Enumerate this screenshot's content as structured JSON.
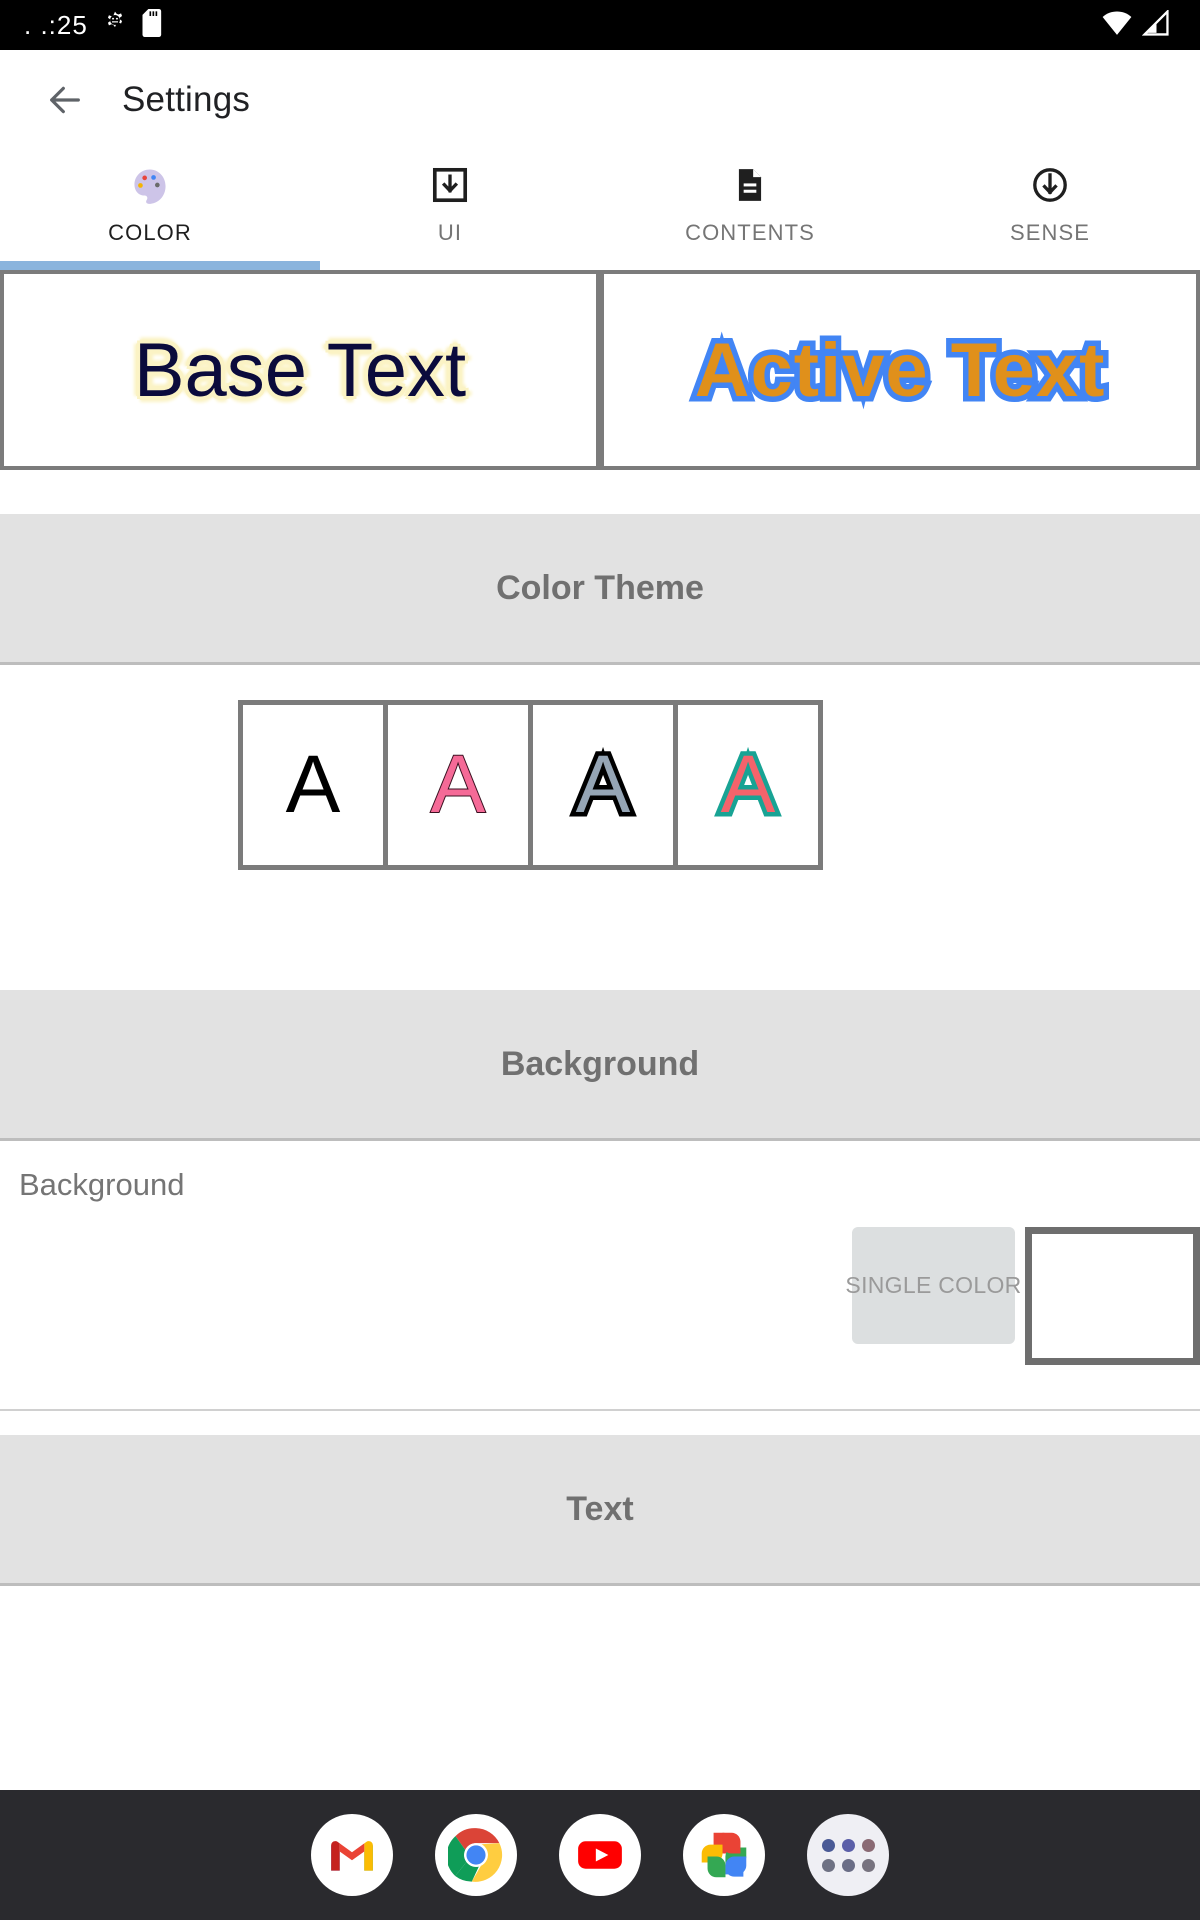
{
  "status_bar": {
    "clock": ". .:25",
    "left_icons": [
      "android-gear-icon",
      "sd-card-icon"
    ],
    "right_icons": [
      "wifi-icon",
      "cellular-signal-icon"
    ]
  },
  "app_bar": {
    "back_icon": "back-arrow-icon",
    "title": "Settings"
  },
  "tabs": [
    {
      "label": "COLOR",
      "icon": "palette-icon",
      "active": true
    },
    {
      "label": "UI",
      "icon": "download-box-icon",
      "active": false
    },
    {
      "label": "CONTENTS",
      "icon": "document-icon",
      "active": false
    },
    {
      "label": "SENSE",
      "icon": "circle-down-arrow-icon",
      "active": false
    }
  ],
  "preview": {
    "base_text": "Base Text",
    "active_text": "Active Text",
    "base_text_color": "#0b0b3c",
    "base_glow_color": "#fbf3c5",
    "active_text_color": "#e0901b",
    "active_stroke_color": "#4285f4"
  },
  "sections": {
    "color_theme": {
      "header": "Color Theme",
      "swatches": [
        {
          "glyph": "A",
          "name": "theme-swatch-black"
        },
        {
          "glyph": "A",
          "name": "theme-swatch-pink"
        },
        {
          "glyph": "A",
          "name": "theme-swatch-gray"
        },
        {
          "glyph": "A",
          "name": "theme-swatch-salmon-teal"
        }
      ]
    },
    "background": {
      "header": "Background",
      "row_label": "Background",
      "button_label": "SINGLE COLOR",
      "swatch_color": "#ffffff"
    },
    "text": {
      "header": "Text"
    }
  },
  "dock": {
    "items": [
      {
        "name": "gmail-icon"
      },
      {
        "name": "chrome-icon"
      },
      {
        "name": "youtube-icon"
      },
      {
        "name": "google-photos-icon"
      },
      {
        "name": "app-drawer-icon"
      }
    ]
  },
  "colors": {
    "accent_indicator": "#8ab4dd",
    "section_header_bg": "#e2e2e2",
    "section_header_text": "#707070"
  }
}
